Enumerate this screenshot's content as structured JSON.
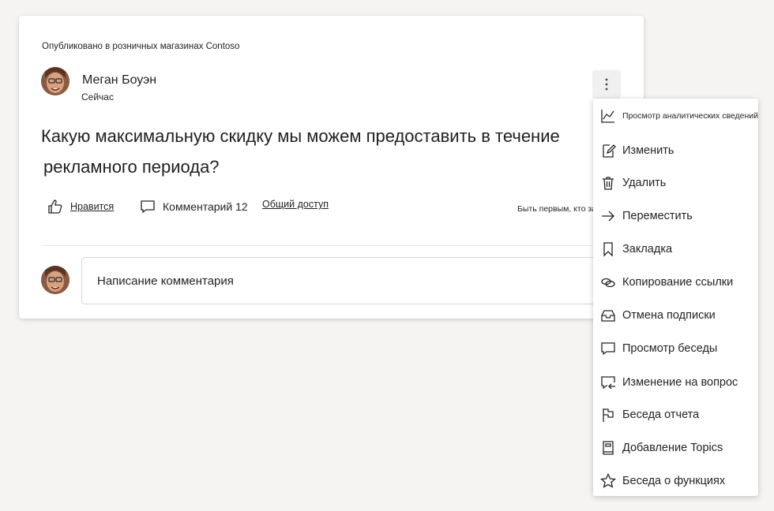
{
  "post": {
    "posted_in": "Опубликовано в розничных магазинах Contoso",
    "author": "Меган Боуэн",
    "timestamp": "Сейчас",
    "question_line1": "Какую максимальную скидку мы можем предоставить в течение",
    "question_line2": "рекламного периода?",
    "actions": {
      "like": "Нравится",
      "comment": "Комментарий 12",
      "share": "Общий доступ"
    },
    "be_first": "Быть первым, кто заболел",
    "comment_placeholder": "Написание комментария"
  },
  "menu": {
    "items": [
      {
        "label": "Просмотр аналитических сведений",
        "icon": "chart-line-icon"
      },
      {
        "label": "Изменить",
        "icon": "edit-icon"
      },
      {
        "label": "Удалить",
        "icon": "trash-icon"
      },
      {
        "label": "Переместить",
        "icon": "arrow-right-icon"
      },
      {
        "label": "Закладка",
        "icon": "bookmark-icon"
      },
      {
        "label": "Копирование ссылки",
        "icon": "link-icon"
      },
      {
        "label": "Отмена подписки",
        "icon": "mail-inbox-icon"
      },
      {
        "label": "Просмотр беседы",
        "icon": "chat-bubble-icon"
      },
      {
        "label": "Изменение на вопрос",
        "icon": "chat-arrow-icon"
      },
      {
        "label": "Беседа отчета",
        "icon": "flag-icon"
      },
      {
        "label": "Добавление Topics",
        "icon": "book-icon"
      },
      {
        "label": "Беседа о функциях",
        "icon": "star-icon"
      }
    ]
  }
}
